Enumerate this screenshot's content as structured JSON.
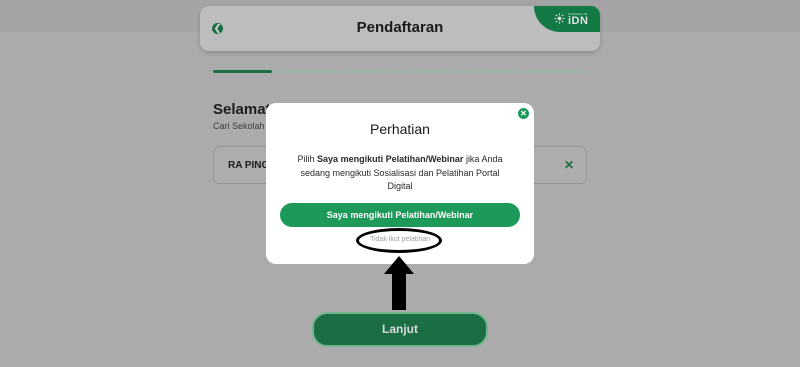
{
  "header": {
    "title": "Pendaftaran",
    "back_icon": "chevron-left-icon",
    "brand": {
      "small_text": "KURIKULUM",
      "name": "iDN"
    }
  },
  "progress": {
    "total_steps": 6,
    "current_step": 1
  },
  "background": {
    "heading": "Selamat",
    "subtext": "Cari Sekolah",
    "selected_school": "RA PING",
    "clear_icon": "close-icon"
  },
  "next_button": {
    "label": "Lanjut"
  },
  "modal": {
    "title": "Perhatian",
    "body_prefix": "Pilih ",
    "body_bold": "Saya mengikuti Pelatihan/Webinar",
    "body_suffix": " jika Anda sedang mengikuti Sosialisasi dan Pelatihan Portal Digital",
    "primary_label": "Saya mengikuti Pelatihan/Webinar",
    "secondary_label": "Tidak ikut pelatihan",
    "close_icon": "close-icon"
  },
  "colors": {
    "brand_green": "#1d9a5a",
    "dark_green": "#1b6e44",
    "overlay": "#ababab",
    "annotation": "#000000"
  }
}
